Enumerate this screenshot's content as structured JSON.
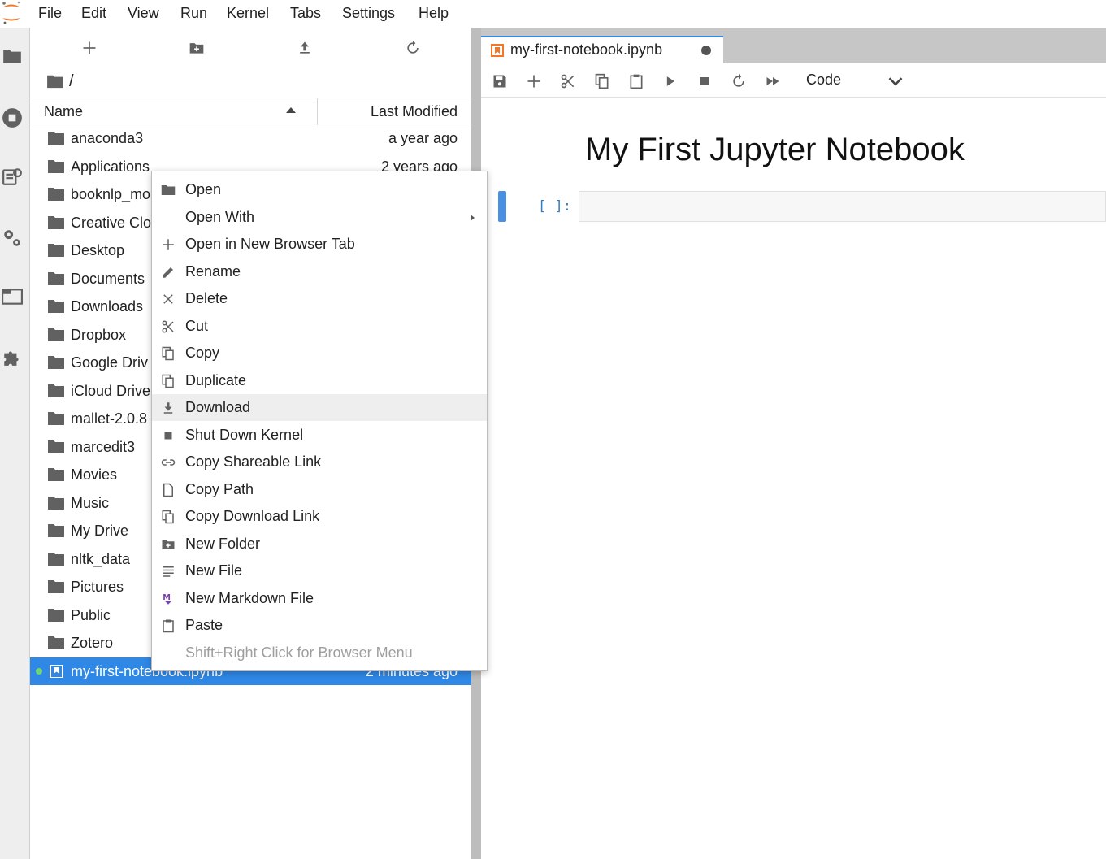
{
  "menubar": {
    "items": [
      "File",
      "Edit",
      "View",
      "Run",
      "Kernel",
      "Tabs",
      "Settings",
      "Help"
    ]
  },
  "activity_bar": {
    "icons": [
      "folder-icon",
      "running-icon",
      "commands-icon",
      "property-inspector-icon",
      "tabs-icon",
      "extension-icon"
    ]
  },
  "file_browser": {
    "toolbar": [
      "new-launcher-icon",
      "new-folder-icon",
      "upload-icon",
      "refresh-icon"
    ],
    "breadcrumb": "/",
    "header": {
      "name": "Name",
      "modified": "Last Modified"
    },
    "rows": [
      {
        "name": "anaconda3",
        "modified": "a year ago"
      },
      {
        "name": "Applications",
        "modified": "2 years ago"
      },
      {
        "name": "booknlp_mo",
        "modified": ""
      },
      {
        "name": "Creative Clo",
        "modified": ""
      },
      {
        "name": "Desktop",
        "modified": ""
      },
      {
        "name": "Documents",
        "modified": ""
      },
      {
        "name": "Downloads",
        "modified": ""
      },
      {
        "name": "Dropbox",
        "modified": ""
      },
      {
        "name": "Google Driv",
        "modified": ""
      },
      {
        "name": "iCloud Drive",
        "modified": ""
      },
      {
        "name": "mallet-2.0.8",
        "modified": ""
      },
      {
        "name": "marcedit3",
        "modified": ""
      },
      {
        "name": "Movies",
        "modified": ""
      },
      {
        "name": "Music",
        "modified": ""
      },
      {
        "name": "My Drive",
        "modified": ""
      },
      {
        "name": "nltk_data",
        "modified": ""
      },
      {
        "name": "Pictures",
        "modified": ""
      },
      {
        "name": "Public",
        "modified": ""
      },
      {
        "name": "Zotero",
        "modified": ""
      },
      {
        "name": "my-first-notebook.ipynb",
        "modified": "2 minutes ago"
      }
    ]
  },
  "notebook": {
    "tab_label": "my-first-notebook.ipynb",
    "cell_type": "Code",
    "heading": "My First Jupyter Notebook",
    "prompt": "[ ]:"
  },
  "context_menu": {
    "items": [
      {
        "label": "Open",
        "icon": "folder-icon"
      },
      {
        "label": "Open With",
        "icon": "",
        "submenu": true
      },
      {
        "label": "Open in New Browser Tab",
        "icon": "add-icon"
      },
      {
        "label": "Rename",
        "icon": "edit-icon"
      },
      {
        "label": "Delete",
        "icon": "close-icon"
      },
      {
        "label": "Cut",
        "icon": "cut-icon"
      },
      {
        "label": "Copy",
        "icon": "copy-icon"
      },
      {
        "label": "Duplicate",
        "icon": "copy-icon"
      },
      {
        "label": "Download",
        "icon": "download-icon"
      },
      {
        "label": "Shut Down Kernel",
        "icon": "stop-icon"
      },
      {
        "label": "Copy Shareable Link",
        "icon": "link-icon"
      },
      {
        "label": "Copy Path",
        "icon": "file-icon"
      },
      {
        "label": "Copy Download Link",
        "icon": "copy-icon"
      },
      {
        "label": "New Folder",
        "icon": "new-folder-icon"
      },
      {
        "label": "New File",
        "icon": "text-file-icon"
      },
      {
        "label": "New Markdown File",
        "icon": "markdown-icon"
      },
      {
        "label": "Paste",
        "icon": "paste-icon"
      },
      {
        "label": "Shift+Right Click for Browser Menu",
        "icon": ""
      }
    ]
  }
}
